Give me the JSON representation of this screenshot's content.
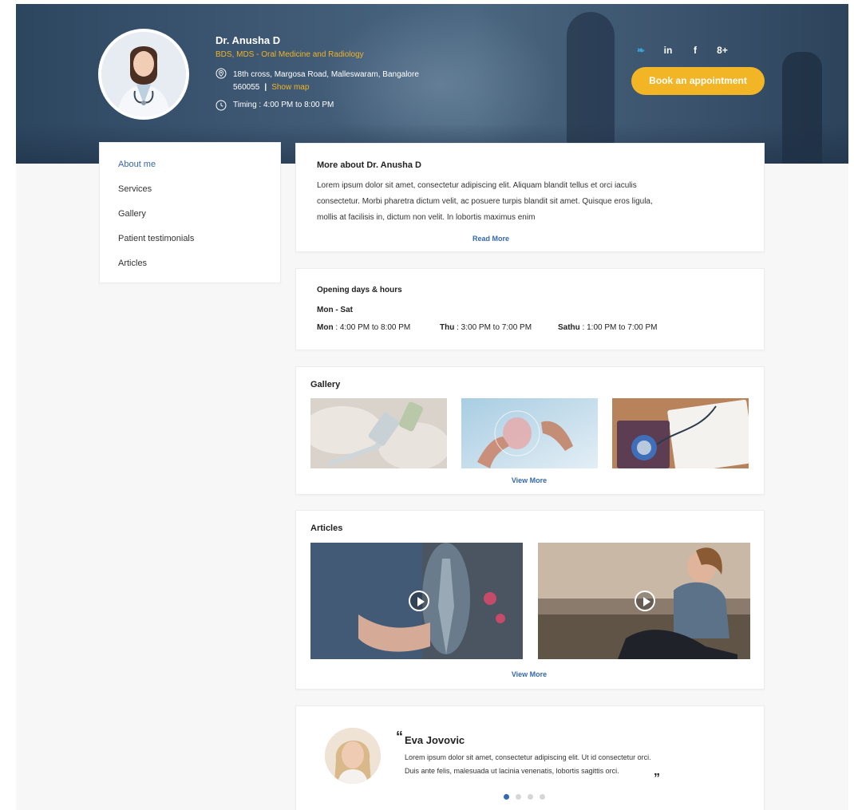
{
  "doctor": {
    "name": "Dr. Anusha D",
    "degree": "BDS, MDS - Oral Medicine and Radiology",
    "address_line1": "18th cross, Margosa Road, Malleswaram, Bangalore",
    "address_line2": "560055",
    "address_sep": "|",
    "show_map": "Show map",
    "timing": "Timing : 4:00 PM to 8:00 PM"
  },
  "social": {
    "twitter": "❧",
    "linkedin": "in",
    "facebook": "f",
    "google": "8+"
  },
  "book_button": "Book an appointment",
  "sidebar": {
    "items": [
      {
        "label": "About me",
        "active": true
      },
      {
        "label": "Services",
        "active": false
      },
      {
        "label": "Gallery",
        "active": false
      },
      {
        "label": "Patient testimonials",
        "active": false
      },
      {
        "label": "Articles",
        "active": false
      }
    ]
  },
  "about": {
    "title": "More about Dr. Anusha D",
    "line1": "Lorem ipsum dolor sit amet, consectetur adipiscing elit. Aliquam blandit tellus et orci iaculis",
    "line2": "consectetur. Morbi pharetra dictum velit, ac posuere turpis blandit sit amet. Quisque eros ligula,",
    "line3": "mollis at facilisis in, dictum non velit. In lobortis maximus enim",
    "read_more": "Read More"
  },
  "hours": {
    "title": "Opening days & hours",
    "range": "Mon - Sat",
    "slots": [
      {
        "day": "Mon",
        "time": " : 4:00 PM to 8:00 PM"
      },
      {
        "day": "Thu",
        "time": " : 3:00 PM to 7:00 PM"
      },
      {
        "day": "Sathu",
        "time": " : 1:00 PM to 7:00 PM"
      }
    ]
  },
  "gallery": {
    "title": "Gallery",
    "view_more": "View More"
  },
  "articles": {
    "title": "Articles",
    "view_more": "View More"
  },
  "testimonial": {
    "quote_open": "“",
    "name": "Eva Jovovic",
    "line1": "Lorem ipsum dolor sit amet, consectetur adipiscing elit. Ut id consectetur orci.",
    "line2": "Duis ante felis, malesuada ut lacinia venenatis, lobortis sagittis orci.",
    "quote_close": "„",
    "dots_total": 4,
    "dot_active": 1
  },
  "colors": {
    "accent_yellow": "#f2b526",
    "link_blue": "#3568b0"
  }
}
